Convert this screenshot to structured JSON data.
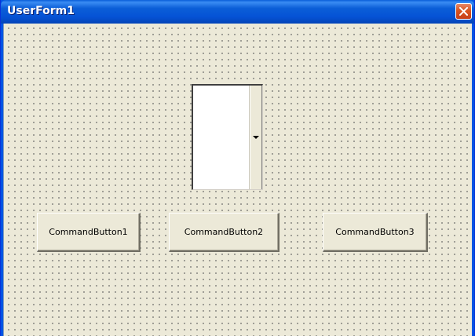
{
  "window": {
    "title": "UserForm1",
    "close_icon": "close-icon"
  },
  "form": {
    "listbox": {
      "items": [],
      "dropdown_icon": "dropdown-arrow-icon"
    },
    "buttons": [
      {
        "label": "CommandButton1"
      },
      {
        "label": "CommandButton2"
      },
      {
        "label": "CommandButton3"
      }
    ]
  },
  "colors": {
    "titlebar": "#0054e3",
    "client_bg": "#ece9d8",
    "close_button": "#d9531e"
  }
}
